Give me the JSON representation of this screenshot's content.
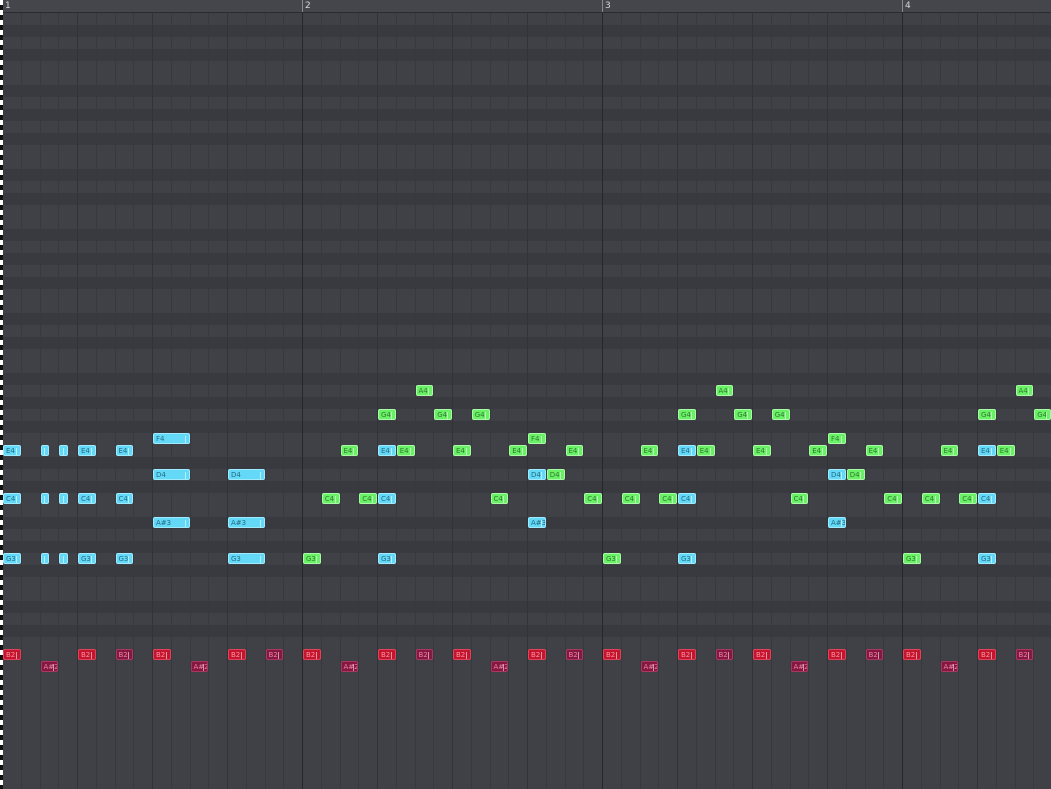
{
  "ruler": {
    "bars": [
      "1",
      "2",
      "3",
      "4"
    ]
  },
  "notes": [
    {
      "c": "cyan",
      "p": "E4",
      "s": 0,
      "l": 1,
      "label": "E4"
    },
    {
      "c": "cyan",
      "p": "E4",
      "s": 2,
      "l": 0.5,
      "label": ""
    },
    {
      "c": "cyan",
      "p": "E4",
      "s": 3,
      "l": 0.5,
      "label": ""
    },
    {
      "c": "cyan",
      "p": "E4",
      "s": 4,
      "l": 1,
      "label": "E4"
    },
    {
      "c": "cyan",
      "p": "E4",
      "s": 6,
      "l": 1,
      "label": "E4"
    },
    {
      "c": "cyan",
      "p": "C4",
      "s": 0,
      "l": 1,
      "label": "C4"
    },
    {
      "c": "cyan",
      "p": "C4",
      "s": 2,
      "l": 0.5,
      "label": ""
    },
    {
      "c": "cyan",
      "p": "C4",
      "s": 3,
      "l": 0.5,
      "label": ""
    },
    {
      "c": "cyan",
      "p": "C4",
      "s": 4,
      "l": 1,
      "label": "C4"
    },
    {
      "c": "cyan",
      "p": "C4",
      "s": 6,
      "l": 1,
      "label": "C4"
    },
    {
      "c": "cyan",
      "p": "G3",
      "s": 0,
      "l": 1,
      "label": "G3"
    },
    {
      "c": "cyan",
      "p": "G3",
      "s": 2,
      "l": 0.5,
      "label": ""
    },
    {
      "c": "cyan",
      "p": "G3",
      "s": 3,
      "l": 0.5,
      "label": ""
    },
    {
      "c": "cyan",
      "p": "G3",
      "s": 4,
      "l": 1,
      "label": "G3"
    },
    {
      "c": "cyan",
      "p": "G3",
      "s": 6,
      "l": 1,
      "label": "G3"
    },
    {
      "c": "cyan",
      "p": "F4",
      "s": 8,
      "l": 2,
      "label": "F4"
    },
    {
      "c": "cyan",
      "p": "D4",
      "s": 8,
      "l": 2,
      "label": "D4"
    },
    {
      "c": "cyan",
      "p": "A#3",
      "s": 8,
      "l": 2,
      "label": "A#3"
    },
    {
      "c": "cyan",
      "p": "D4",
      "s": 12,
      "l": 2,
      "label": "D4"
    },
    {
      "c": "cyan",
      "p": "A#3",
      "s": 12,
      "l": 2,
      "label": "A#3"
    },
    {
      "c": "cyan",
      "p": "G3",
      "s": 12,
      "l": 2,
      "label": "G3"
    },
    {
      "c": "green",
      "p": "G3",
      "s": 16,
      "l": 1,
      "label": "G3"
    },
    {
      "c": "green",
      "p": "C4",
      "s": 17,
      "l": 1,
      "label": "C4"
    },
    {
      "c": "green",
      "p": "E4",
      "s": 18,
      "l": 1,
      "label": "E4"
    },
    {
      "c": "green",
      "p": "C4",
      "s": 19,
      "l": 1,
      "label": "C4"
    },
    {
      "c": "cyan",
      "p": "E4",
      "s": 20,
      "l": 1,
      "label": "E4"
    },
    {
      "c": "cyan",
      "p": "C4",
      "s": 20,
      "l": 1,
      "label": "C4"
    },
    {
      "c": "cyan",
      "p": "G3",
      "s": 20,
      "l": 1,
      "label": "G3"
    },
    {
      "c": "green",
      "p": "G4",
      "s": 20,
      "l": 1,
      "label": "G4"
    },
    {
      "c": "green",
      "p": "E4",
      "s": 21,
      "l": 1,
      "label": "E4"
    },
    {
      "c": "green",
      "p": "A4",
      "s": 22,
      "l": 1,
      "label": "A4"
    },
    {
      "c": "green",
      "p": "G4",
      "s": 23,
      "l": 1,
      "label": "G4"
    },
    {
      "c": "green",
      "p": "E4",
      "s": 24,
      "l": 1,
      "label": "E4"
    },
    {
      "c": "green",
      "p": "G4",
      "s": 25,
      "l": 1,
      "label": "G4"
    },
    {
      "c": "green",
      "p": "C4",
      "s": 26,
      "l": 1,
      "label": "C4"
    },
    {
      "c": "green",
      "p": "E4",
      "s": 27,
      "l": 1,
      "label": "E4"
    },
    {
      "c": "green",
      "p": "F4",
      "s": 28,
      "l": 1,
      "label": "F4"
    },
    {
      "c": "cyan",
      "p": "D4",
      "s": 28,
      "l": 1,
      "label": "D4"
    },
    {
      "c": "cyan",
      "p": "A#3",
      "s": 28,
      "l": 1,
      "label": "A#3"
    },
    {
      "c": "green",
      "p": "D4",
      "s": 29,
      "l": 1,
      "label": "D4"
    },
    {
      "c": "green",
      "p": "E4",
      "s": 30,
      "l": 1,
      "label": "E4"
    },
    {
      "c": "green",
      "p": "C4",
      "s": 31,
      "l": 1,
      "label": "C4"
    },
    {
      "c": "green",
      "p": "G3",
      "s": 32,
      "l": 1,
      "label": "G3"
    },
    {
      "c": "green",
      "p": "C4",
      "s": 33,
      "l": 1,
      "label": "C4"
    },
    {
      "c": "green",
      "p": "E4",
      "s": 34,
      "l": 1,
      "label": "E4"
    },
    {
      "c": "green",
      "p": "C4",
      "s": 35,
      "l": 1,
      "label": "C4"
    },
    {
      "c": "cyan",
      "p": "E4",
      "s": 36,
      "l": 1,
      "label": "E4"
    },
    {
      "c": "cyan",
      "p": "C4",
      "s": 36,
      "l": 1,
      "label": "C4"
    },
    {
      "c": "cyan",
      "p": "G3",
      "s": 36,
      "l": 1,
      "label": "G3"
    },
    {
      "c": "green",
      "p": "G4",
      "s": 36,
      "l": 1,
      "label": "G4"
    },
    {
      "c": "green",
      "p": "E4",
      "s": 37,
      "l": 1,
      "label": "E4"
    },
    {
      "c": "green",
      "p": "A4",
      "s": 38,
      "l": 1,
      "label": "A4"
    },
    {
      "c": "green",
      "p": "G4",
      "s": 39,
      "l": 1,
      "label": "G4"
    },
    {
      "c": "green",
      "p": "E4",
      "s": 40,
      "l": 1,
      "label": "E4"
    },
    {
      "c": "green",
      "p": "G4",
      "s": 41,
      "l": 1,
      "label": "G4"
    },
    {
      "c": "green",
      "p": "C4",
      "s": 42,
      "l": 1,
      "label": "C4"
    },
    {
      "c": "green",
      "p": "E4",
      "s": 43,
      "l": 1,
      "label": "E4"
    },
    {
      "c": "green",
      "p": "F4",
      "s": 44,
      "l": 1,
      "label": "F4"
    },
    {
      "c": "cyan",
      "p": "D4",
      "s": 44,
      "l": 1,
      "label": "D4"
    },
    {
      "c": "cyan",
      "p": "A#3",
      "s": 44,
      "l": 1,
      "label": "A#3"
    },
    {
      "c": "green",
      "p": "D4",
      "s": 45,
      "l": 1,
      "label": "D4"
    },
    {
      "c": "green",
      "p": "E4",
      "s": 46,
      "l": 1,
      "label": "E4"
    },
    {
      "c": "green",
      "p": "C4",
      "s": 47,
      "l": 1,
      "label": "C4"
    },
    {
      "c": "green",
      "p": "G3",
      "s": 48,
      "l": 1,
      "label": "G3"
    },
    {
      "c": "green",
      "p": "C4",
      "s": 49,
      "l": 1,
      "label": "C4"
    },
    {
      "c": "green",
      "p": "E4",
      "s": 50,
      "l": 1,
      "label": "E4"
    },
    {
      "c": "green",
      "p": "C4",
      "s": 51,
      "l": 1,
      "label": "C4"
    },
    {
      "c": "cyan",
      "p": "E4",
      "s": 52,
      "l": 1,
      "label": "E4"
    },
    {
      "c": "cyan",
      "p": "C4",
      "s": 52,
      "l": 1,
      "label": "C4"
    },
    {
      "c": "cyan",
      "p": "G3",
      "s": 52,
      "l": 1,
      "label": "G3"
    },
    {
      "c": "green",
      "p": "G4",
      "s": 52,
      "l": 1,
      "label": "G4"
    },
    {
      "c": "green",
      "p": "E4",
      "s": 53,
      "l": 1,
      "label": "E4"
    },
    {
      "c": "green",
      "p": "A4",
      "s": 54,
      "l": 1,
      "label": "A4"
    },
    {
      "c": "green",
      "p": "G4",
      "s": 55,
      "l": 1,
      "label": "G4"
    },
    {
      "c": "red",
      "p": "B2",
      "s": 0,
      "l": 1,
      "label": "B2"
    },
    {
      "c": "maroon",
      "p": "A#2",
      "s": 2,
      "l": 1,
      "label": "A#2"
    },
    {
      "c": "red",
      "p": "B2",
      "s": 4,
      "l": 1,
      "label": "B2"
    },
    {
      "c": "maroon",
      "p": "B2",
      "s": 6,
      "l": 1,
      "label": "B2"
    },
    {
      "c": "red",
      "p": "B2",
      "s": 8,
      "l": 1,
      "label": "B2"
    },
    {
      "c": "maroon",
      "p": "A#2",
      "s": 10,
      "l": 1,
      "label": "A#2"
    },
    {
      "c": "red",
      "p": "B2",
      "s": 12,
      "l": 1,
      "label": "B2"
    },
    {
      "c": "maroon",
      "p": "B2",
      "s": 14,
      "l": 1,
      "label": "B2"
    },
    {
      "c": "red",
      "p": "B2",
      "s": 16,
      "l": 1,
      "label": "B2"
    },
    {
      "c": "maroon",
      "p": "A#2",
      "s": 18,
      "l": 1,
      "label": "A#2"
    },
    {
      "c": "red",
      "p": "B2",
      "s": 20,
      "l": 1,
      "label": "B2"
    },
    {
      "c": "maroon",
      "p": "B2",
      "s": 22,
      "l": 1,
      "label": "B2"
    },
    {
      "c": "red",
      "p": "B2",
      "s": 24,
      "l": 1,
      "label": "B2"
    },
    {
      "c": "maroon",
      "p": "A#2",
      "s": 26,
      "l": 1,
      "label": "A#2"
    },
    {
      "c": "red",
      "p": "B2",
      "s": 28,
      "l": 1,
      "label": "B2"
    },
    {
      "c": "maroon",
      "p": "B2",
      "s": 30,
      "l": 1,
      "label": "B2"
    },
    {
      "c": "red",
      "p": "B2",
      "s": 32,
      "l": 1,
      "label": "B2"
    },
    {
      "c": "maroon",
      "p": "A#2",
      "s": 34,
      "l": 1,
      "label": "A#2"
    },
    {
      "c": "red",
      "p": "B2",
      "s": 36,
      "l": 1,
      "label": "B2"
    },
    {
      "c": "maroon",
      "p": "B2",
      "s": 38,
      "l": 1,
      "label": "B2"
    },
    {
      "c": "red",
      "p": "B2",
      "s": 40,
      "l": 1,
      "label": "B2"
    },
    {
      "c": "maroon",
      "p": "A#2",
      "s": 42,
      "l": 1,
      "label": "A#2"
    },
    {
      "c": "red",
      "p": "B2",
      "s": 44,
      "l": 1,
      "label": "B2"
    },
    {
      "c": "maroon",
      "p": "B2",
      "s": 46,
      "l": 1,
      "label": "B2"
    },
    {
      "c": "red",
      "p": "B2",
      "s": 48,
      "l": 1,
      "label": "B2"
    },
    {
      "c": "maroon",
      "p": "A#2",
      "s": 50,
      "l": 1,
      "label": "A#2"
    },
    {
      "c": "red",
      "p": "B2",
      "s": 52,
      "l": 1,
      "label": "B2"
    },
    {
      "c": "maroon",
      "p": "B2",
      "s": 54,
      "l": 1,
      "label": "B2"
    }
  ]
}
